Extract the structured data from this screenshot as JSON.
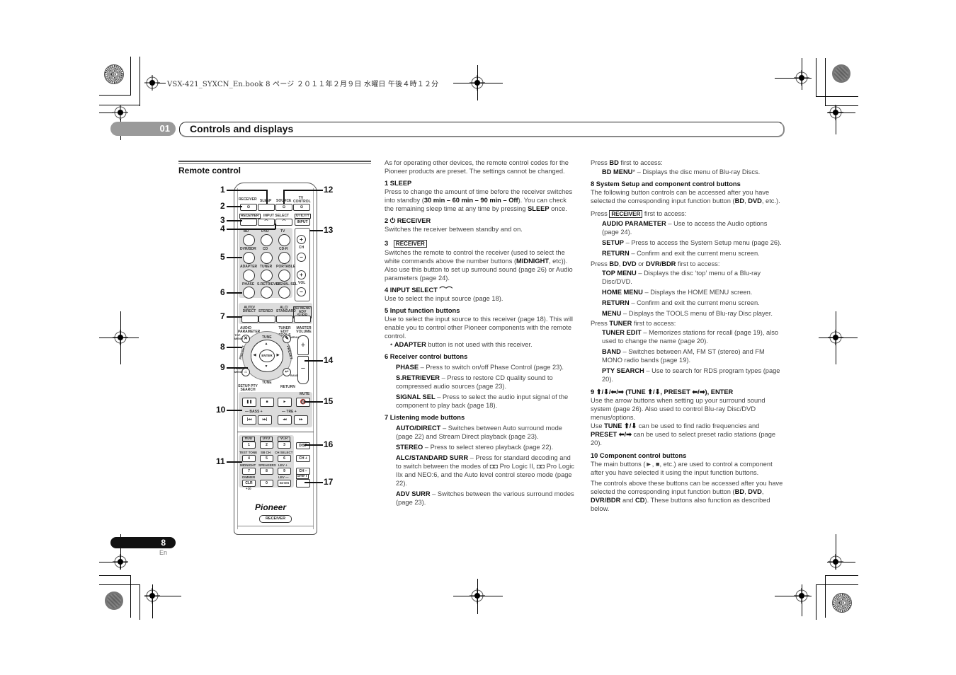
{
  "print_header": "VSX-421_SYXCN_En.book  8 ページ  ２０１１年２月９日  水曜日  午後４時１２分",
  "chapter": {
    "number": "01",
    "title": "Controls and displays"
  },
  "section_title": "Remote control",
  "page": {
    "number": "8",
    "lang": "En"
  },
  "remote": {
    "callouts": [
      "1",
      "2",
      "3",
      "4",
      "5",
      "6",
      "7",
      "8",
      "9",
      "10",
      "11",
      "12",
      "13",
      "14",
      "15",
      "16",
      "17"
    ],
    "top_labels": {
      "receiver": "RECEIVER",
      "sleep": "SLEEP",
      "source": "SOURCE",
      "tv_control": "TV CONTROL"
    },
    "receiver_mode": "RECEIVER",
    "input_select": "INPUT SELECT",
    "utility": "UTILITY",
    "input": "INPUT",
    "input_buttons": [
      "BD",
      "DVD",
      "TV",
      "DVR/BDR",
      "CD",
      "CD-R",
      "ADAPTER",
      "TUNER",
      "PORTABLE"
    ],
    "receiver_buttons": [
      "PHASE",
      "S.RETRIEVER",
      "SIGNAL SEL"
    ],
    "ch": "CH",
    "vol": "VOL",
    "listening_modes": [
      "AUTO/ DIRECT",
      "STEREO",
      "ALC/ STANDARD",
      "BD MENU ADV SURR"
    ],
    "audio_parameter": "AUDIO PARAMETER",
    "top_menu": "TOP MENU",
    "tuner_edit": "TUNER EDIT TOOLS",
    "menu": "MENU",
    "master_volume": "MASTER VOLUME",
    "tune": "TUNE",
    "preset": "PRESET",
    "enter": "ENTER",
    "home_menu": "HOME MENU",
    "setup": "SETUP PTY SEARCH",
    "band": "BAND",
    "return": "RETURN",
    "mute": "MUTE",
    "transport": [
      "❚❚",
      "■",
      "►"
    ],
    "bass": "— BASS +",
    "tre": "— TRE +",
    "skip": [
      "|◂◂",
      "▸▸|",
      "◂◂",
      "▸▸"
    ],
    "number_top_labels": [
      "HDD",
      "DVD",
      "VCR"
    ],
    "numpad": [
      "1",
      "2",
      "3",
      "4",
      "5",
      "6",
      "7",
      "8",
      "9",
      "CLR",
      "0",
      "ENTER"
    ],
    "numpad_labels": [
      "TEST TONE",
      "SB CH",
      "CH SELECT",
      "MIDNIGHT",
      "SPEAKERS",
      "LEV +",
      "DIMMER",
      "",
      "LEV —"
    ],
    "plus10": "+10",
    "side_buttons": [
      "DISP",
      "CH +",
      "CH –",
      "SHIFT"
    ],
    "brand": "Pioneer",
    "bottom_button": "RECEIVER"
  },
  "col1": {
    "intro": "As for operating other devices, the remote control codes for the Pioneer products are preset. The settings cannot be changed.",
    "items": [
      {
        "h": "1   SLEEP",
        "body_pre": "Press to change the amount of time before the receiver switches into standby (",
        "bold1": "30 min – 60 min – 90 min – Off",
        "body_mid": "). You can check the remaining sleep time at any time by pressing ",
        "bold2": "SLEEP",
        "body_post": " once."
      },
      {
        "h": "2   ⏻ RECEIVER",
        "body": "Switches the receiver between standby and on."
      },
      {
        "h_num": "3",
        "h_box": "RECEIVER",
        "body_pre": "Switches the remote to control the receiver (used to select the white commands above the number buttons (",
        "bold": "MIDNIGHT",
        "body_post": ", etc)). Also use this button to set up surround sound (page 26) or Audio parameters (page 24)."
      },
      {
        "h": "4   INPUT SELECT ⌒⌒",
        "body": "Use to select the input source (page 18)."
      },
      {
        "h": "5   Input function buttons",
        "body": "Use to select the input source to this receiver (page 18). This will enable you to control other Pioneer components with the remote control.",
        "bullet_bold": "ADAPTER",
        "bullet": " button is not used with this receiver."
      },
      {
        "h": "6   Receiver control buttons",
        "entries": [
          {
            "k": "PHASE",
            "v": " – Press to switch on/off Phase Control (page 23)."
          },
          {
            "k": "S.RETRIEVER",
            "v": " – Press to restore CD quality sound to compressed audio sources (page 23)."
          },
          {
            "k": "SIGNAL SEL",
            "v": " – Press to select the audio input signal of the component to play back (page 18)."
          }
        ]
      },
      {
        "h": "7   Listening mode buttons",
        "entries": [
          {
            "k": "AUTO/DIRECT",
            "v": " – Switches between Auto surround mode (page 22) and Stream Direct playback (page 23)."
          },
          {
            "k": "STEREO",
            "v": " – Press to select stereo playback (page 22)."
          },
          {
            "k": "ALC/STANDARD SURR",
            "v": " – Press for standard decoding and to switch between the modes of ◘◘ Pro Logic II, ◘◘ Pro Logic IIx and NEO:6, and the Auto level control stereo mode (page 22)."
          },
          {
            "k": "ADV SURR",
            "v": " – Switches between the various surround modes (page 23)."
          }
        ]
      }
    ]
  },
  "col2": {
    "bd_press": {
      "pre": "Press ",
      "b": "BD",
      "post": " first to access:"
    },
    "bd_menu": {
      "k": "BD MENU",
      "v": "* – Displays the disc menu of Blu-ray Discs."
    },
    "item8": {
      "h": "8   System Setup and component control buttons",
      "body_pre": "The following button controls can be accessed after you have selected the corresponding input function button (",
      "b1": "BD",
      "mid": ", ",
      "b2": "DVD",
      "post": ", etc.)."
    },
    "receiver_press": {
      "pre": "Press ",
      "box": "RECEIVER",
      "post": " first to access:"
    },
    "receiver_entries": [
      {
        "k": "AUDIO PARAMETER",
        "v": " – Use to access the Audio options (page 24)."
      },
      {
        "k": "SETUP",
        "v": " – Press to access the System Setup menu (page 26)."
      },
      {
        "k": "RETURN",
        "v": " – Confirm and exit the current menu screen."
      }
    ],
    "disc_press": {
      "pre": "Press ",
      "b1": "BD",
      "s1": ", ",
      "b2": "DVD",
      "s2": " or ",
      "b3": "DVR/BDR",
      "post": " first to access:"
    },
    "disc_entries": [
      {
        "k": "TOP MENU",
        "v": " – Displays the disc ‘top’ menu of a Blu-ray Disc/DVD."
      },
      {
        "k": "HOME MENU",
        "v": " – Displays the HOME MENU screen."
      },
      {
        "k": "RETURN",
        "v": " – Confirm and exit the current menu screen."
      },
      {
        "k": "MENU",
        "v": " – Displays the TOOLS menu of Blu-ray Disc player."
      }
    ],
    "tuner_press": {
      "pre": "Press ",
      "b": "TUNER",
      "post": " first to access:"
    },
    "tuner_entries": [
      {
        "k": "TUNER EDIT",
        "v": " – Memorizes stations for recall (page 19), also used to change the name (page 20)."
      },
      {
        "k": "BAND",
        "v": " – Switches between AM, FM ST (stereo) and FM MONO radio bands (page 19)."
      },
      {
        "k": "PTY SEARCH",
        "v": " – Use to search for RDS program types (page 20)."
      }
    ],
    "item9": {
      "h": "9   ⬆/⬇/⬅/➡ (TUNE ⬆/⬇, PRESET ⬅/➡), ENTER",
      "body": "Use the arrow buttons when setting up your surround sound system (page 26). Also used to control Blu-ray Disc/DVD menus/options.",
      "tune_pre": "Use ",
      "tune_b": "TUNE ⬆/⬇",
      "tune_post": " can be used to find radio frequencies and ",
      "preset_b": "PRESET ⬅/➡",
      "preset_post": " can be used to select preset radio stations (page 20)."
    },
    "item10": {
      "h": "10  Component control buttons",
      "body1": "The main buttons (►, ■, etc.) are used to control a component after you have selected it using the input function buttons.",
      "body2_pre": "The controls above these buttons can be accessed after you have selected the corresponding input function button (",
      "b1": "BD",
      "s1": ", ",
      "b2": "DVD",
      "s2": ", ",
      "b3": "DVR/BDR",
      "s3": " and ",
      "b4": "CD",
      "body2_post": "). These buttons also function as described below."
    }
  }
}
